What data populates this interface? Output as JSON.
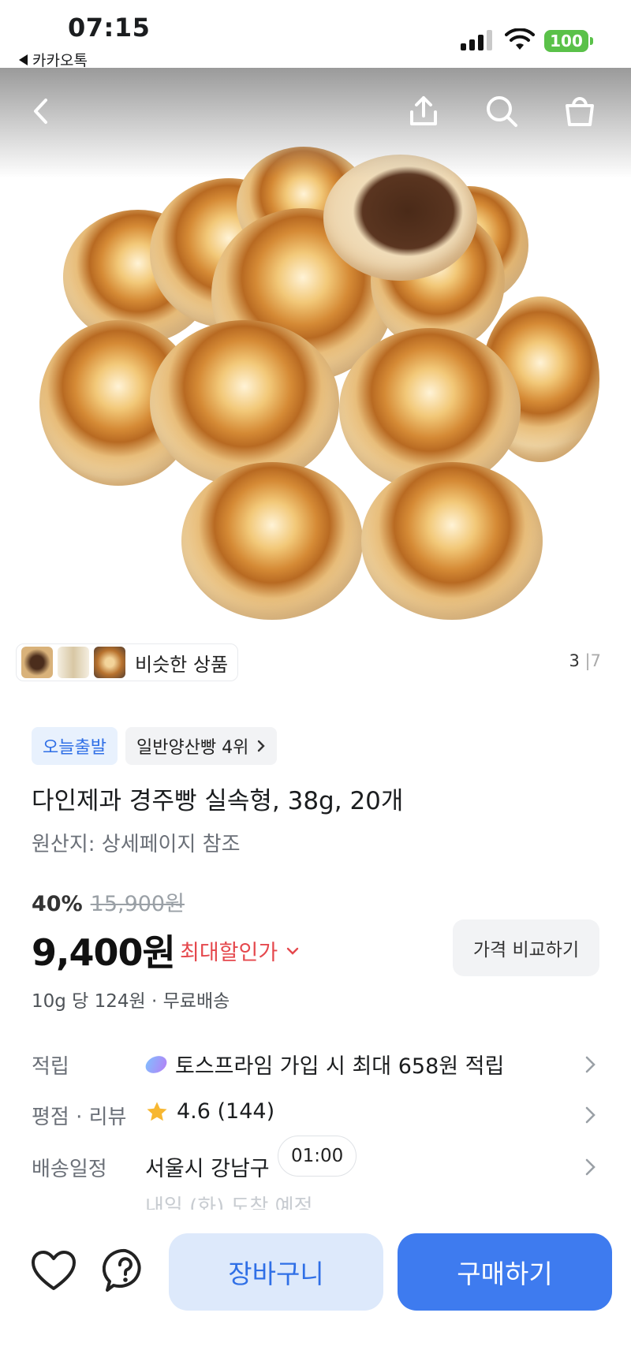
{
  "status_bar": {
    "time": "07:15",
    "back_app": "카카오톡",
    "battery": "100"
  },
  "nav": {
    "icons": [
      "back-icon",
      "share-icon",
      "search-icon",
      "cart-icon"
    ]
  },
  "gallery": {
    "similar_label": "비슷한 상품",
    "current_index": "3",
    "separator": "|",
    "total": "7"
  },
  "product": {
    "badge_today": "오늘출발",
    "badge_rank": "일반양산빵 4위",
    "title": "다인제과 경주빵 실속형, 38g, 20개",
    "origin": "원산지: 상세페이지 참조",
    "discount_percent": "40%",
    "original_price": "15,900원",
    "price": "9,400원",
    "max_discount_label": "최대할인가",
    "compare_button": "가격 비교하기",
    "unit_price_shipping": "10g 당 124원 · 무료배송"
  },
  "info_rows": {
    "points_key": "적립",
    "points_value": "토스프라임 가입 시 최대 658원 적립",
    "rating_key": "평점 · 리뷰",
    "rating_value": "4.6 (144)",
    "delivery_key": "배송일정",
    "delivery_location": "서울시 강남구",
    "delivery_time": "01:00",
    "delivery_eta": "내일 (화) 도착 예정"
  },
  "bottom_bar": {
    "cart_button": "장바구니",
    "buy_button": "구매하기"
  },
  "colors": {
    "accent": "#3e7bef",
    "accent_light": "#dde9fb",
    "discount_red": "#e5484d",
    "star": "#f7b731",
    "battery_green": "#5ac149"
  }
}
